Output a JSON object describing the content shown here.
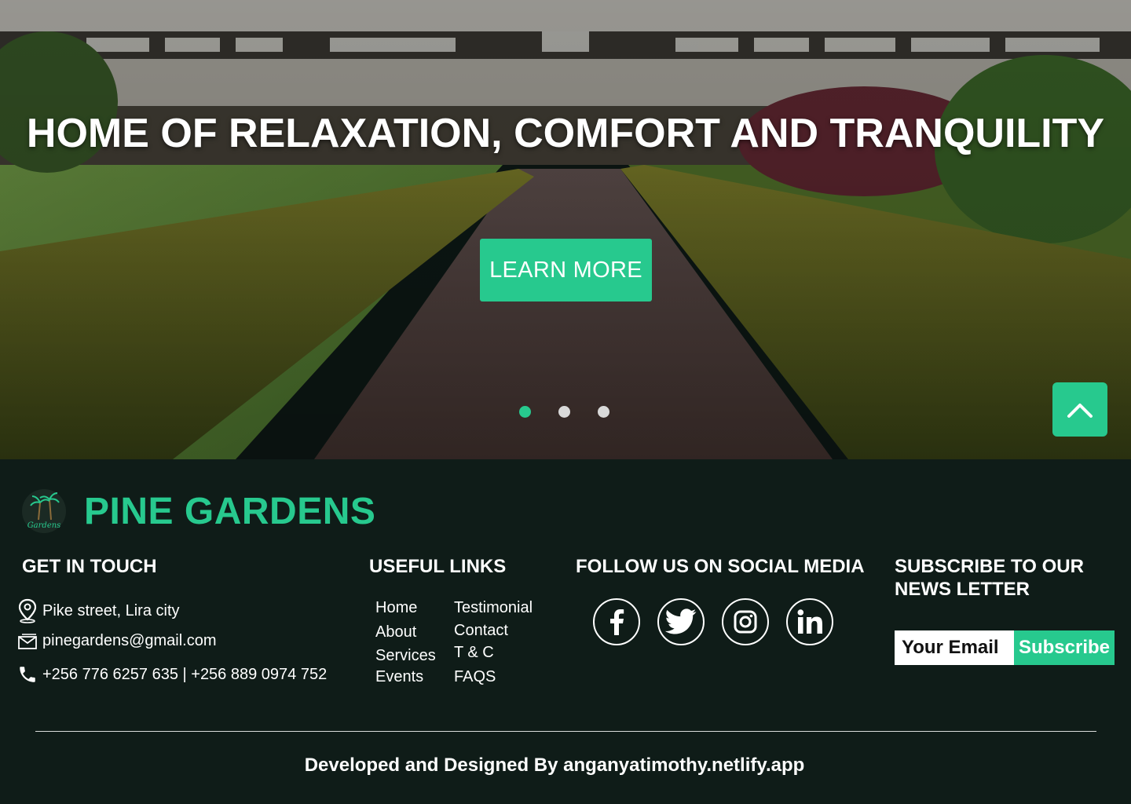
{
  "hero": {
    "title": "HOME OF RELAXATION, COMFORT AND TRANQUILITY",
    "cta_label": "LEARN MORE",
    "slides": [
      {
        "active": true
      },
      {
        "active": false
      },
      {
        "active": false
      }
    ],
    "scroll_top_icon": "chevron-up-icon"
  },
  "footer": {
    "brand": {
      "name": "PINE GARDENS",
      "logo_icon": "palm-tree-logo",
      "logo_text": "Gardens"
    },
    "get_in_touch": {
      "title": "GET IN TOUCH",
      "address": "Pike street, Lira city",
      "email": "pinegardens@gmail.com",
      "phone": "+256 776 6257 635 | +256 889 0974 752"
    },
    "useful_links": {
      "title": "USEFUL LINKS",
      "col1": [
        "Home",
        "About",
        "Services",
        "Events"
      ],
      "col2": [
        "Testimonial",
        "Contact",
        "T & C",
        "FAQS"
      ]
    },
    "social": {
      "title": "FOLLOW US ON SOCIAL MEDIA",
      "icons": [
        "facebook-icon",
        "twitter-icon",
        "instagram-icon",
        "linkedin-icon"
      ]
    },
    "subscribe": {
      "title": "SUBSCRIBE TO OUR NEWS LETTER",
      "placeholder": "Your Email",
      "button_label": "Subscribe"
    },
    "credit": "Developed and Designed By anganyatimothy.netlify.app"
  },
  "colors": {
    "accent": "#27c98e",
    "footer_bg": "#0f1c18"
  }
}
